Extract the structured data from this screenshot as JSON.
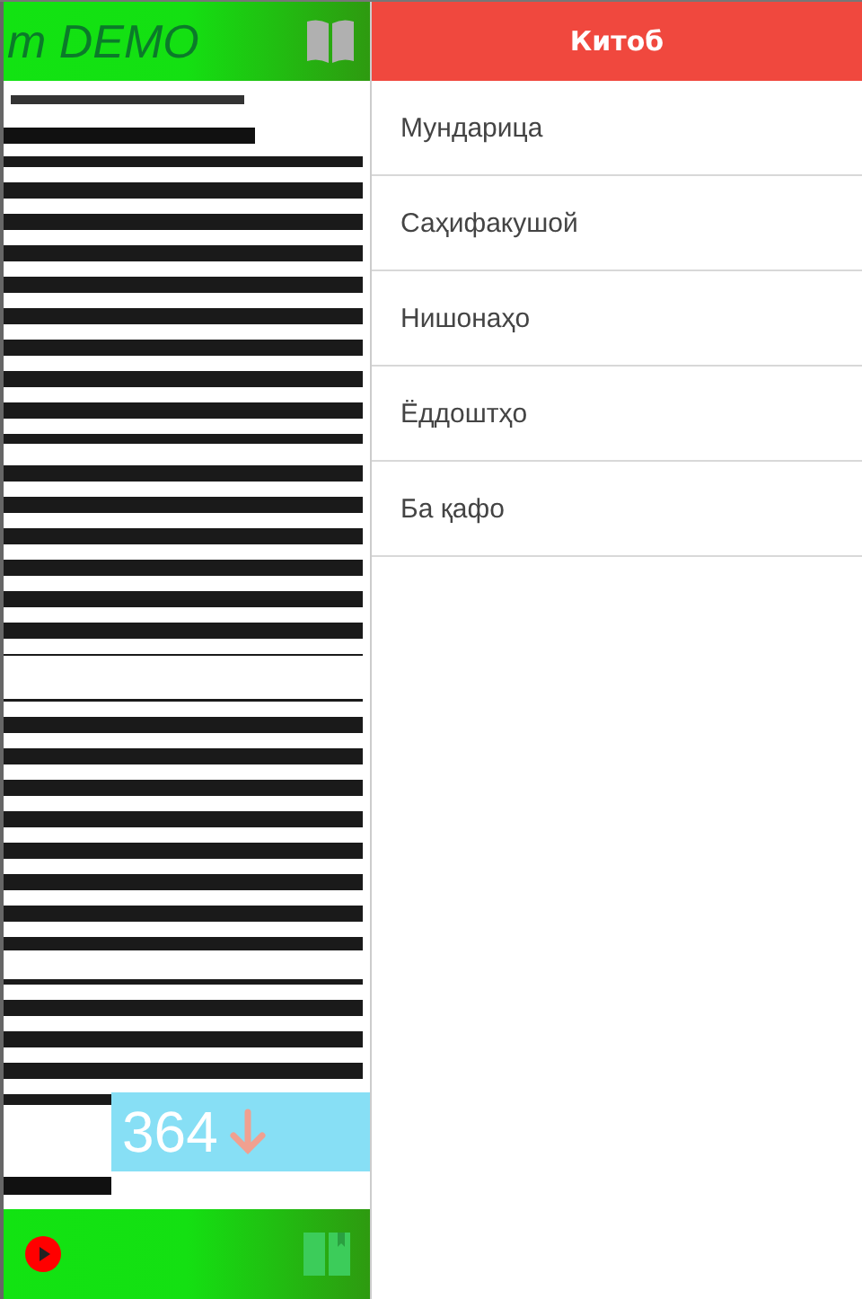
{
  "reader": {
    "title": "m DEMO",
    "page_badge": {
      "number": "364"
    }
  },
  "drawer": {
    "title": "Китоб",
    "items": [
      {
        "label": "Мундарица"
      },
      {
        "label": "Саҳифакушой"
      },
      {
        "label": "Нишонаҳо"
      },
      {
        "label": "Ёддоштҳо"
      },
      {
        "label": "Ба қафо"
      }
    ]
  }
}
